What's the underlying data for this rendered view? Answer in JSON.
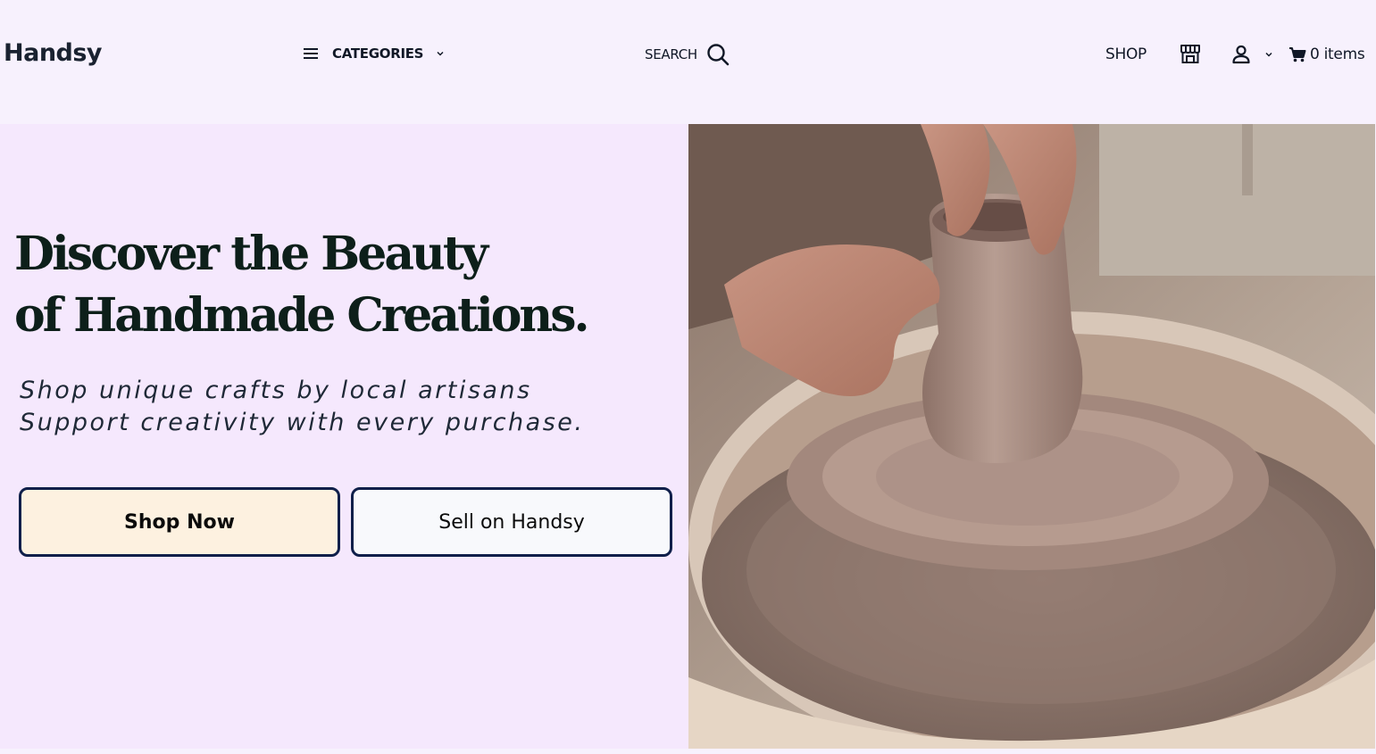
{
  "header": {
    "brand": "Handsy",
    "categories_label": "CATEGORIES",
    "search_label": "SEARCH",
    "shop_label": "SHOP",
    "cart_label": "0 items"
  },
  "hero": {
    "headline_line1": "Discover the Beauty",
    "headline_line2": "of Handmade Creations.",
    "subtext_line1": "Shop unique crafts by local artisans",
    "subtext_line2": "Support creativity with every purchase.",
    "primary_button": "Shop Now",
    "secondary_button": "Sell on Handsy"
  },
  "icons": {
    "menu": "menu-icon",
    "chevron": "chevron-down-icon",
    "search": "search-icon",
    "store": "store-icon",
    "user": "user-icon",
    "cart": "cart-icon"
  },
  "colors": {
    "page_bg": "#f7f1fd",
    "hero_bg": "#f5e8fd",
    "primary_button_bg": "#fdf1e0",
    "secondary_button_bg": "#f8f9fc",
    "button_border": "#0f1f4a",
    "headline": "#0d1f1a"
  }
}
